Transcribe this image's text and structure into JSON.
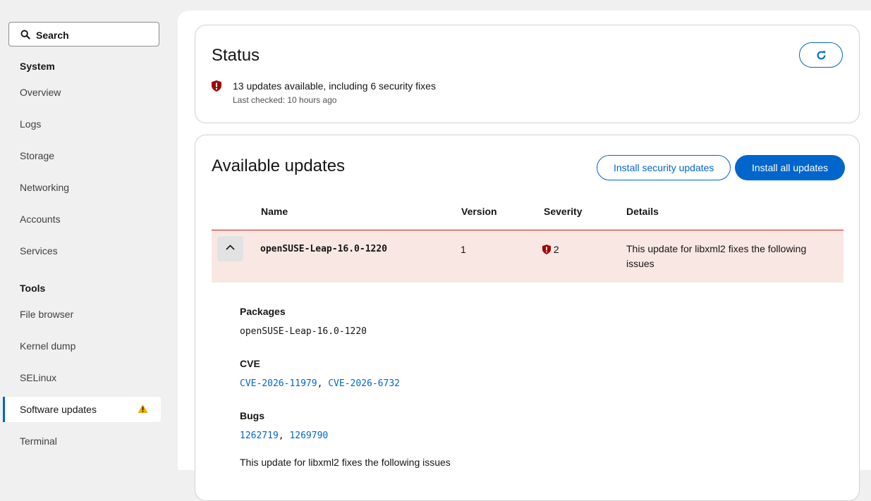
{
  "sidebar": {
    "search_placeholder": "Search",
    "system_title": "System",
    "system_items": [
      "Overview",
      "Logs",
      "Storage",
      "Networking",
      "Accounts",
      "Services"
    ],
    "tools_title": "Tools",
    "tools_items": [
      "File browser",
      "Kernel dump",
      "SELinux",
      "Software updates",
      "Terminal"
    ],
    "active_item": "Software updates",
    "active_item_icon": "warning-triangle-icon"
  },
  "status": {
    "title": "Status",
    "refresh_icon": "refresh-icon",
    "summary": "13 updates available, including 6 security fixes",
    "last_checked": "Last checked: 10 hours ago",
    "summary_icon": "security-shield-icon"
  },
  "updates": {
    "title": "Available updates",
    "install_security_label": "Install security updates",
    "install_all_label": "Install all updates",
    "columns": [
      "Name",
      "Version",
      "Severity",
      "Details"
    ],
    "rows": [
      {
        "name": "openSUSE-Leap-16.0-1220",
        "version": "1",
        "severity": "2",
        "details": "This update for libxml2 fixes the following issues"
      }
    ],
    "expanded": {
      "packages_label": "Packages",
      "packages_value": "openSUSE-Leap-16.0-1220",
      "cve_label": "CVE",
      "cves": [
        "CVE-2026-11979",
        "CVE-2026-6732"
      ],
      "bugs_label": "Bugs",
      "bugs": [
        "1262719",
        "1269790"
      ],
      "description": "This update for libxml2 fixes the following issues"
    }
  },
  "colors": {
    "accent": "#0066cc",
    "danger": "#c9190b",
    "warning": "#f0ab00",
    "row_highlight": "#f9e7e4"
  }
}
